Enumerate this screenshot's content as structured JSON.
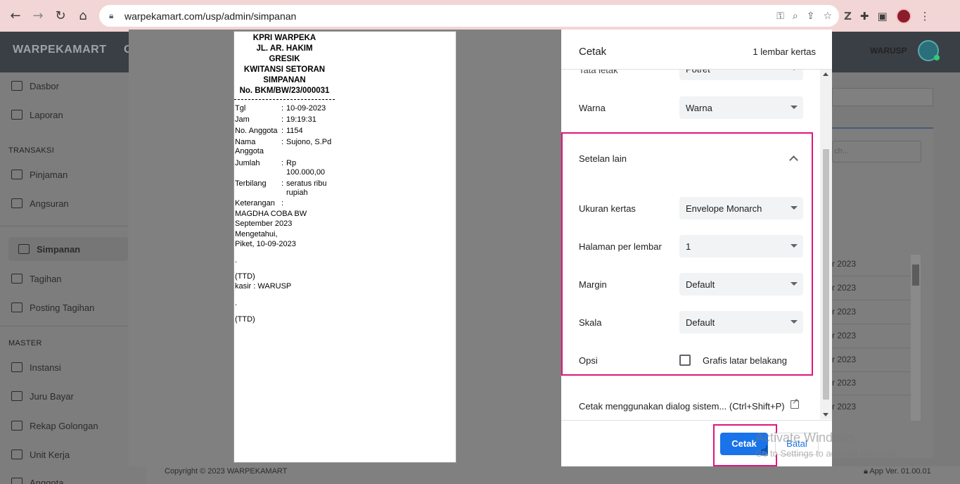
{
  "browser": {
    "url": "warpekamart.com/usp/admin/simpanan"
  },
  "app": {
    "brand": "WARPEKAMART",
    "brand_cut": "C",
    "user": "WARUSP",
    "sidebar": {
      "items_top": [
        {
          "label": "Dasbor",
          "icon": "dashboard-icon"
        },
        {
          "label": "Laporan",
          "icon": "report-icon"
        }
      ],
      "section_transaksi": "TRANSAKSI",
      "items_transaksi": [
        {
          "label": "Pinjaman",
          "icon": "cart-icon"
        },
        {
          "label": "Angsuran",
          "icon": "money-icon"
        }
      ],
      "active_item": {
        "label": "Simpanan",
        "icon": "bank-icon"
      },
      "items_after_active": [
        {
          "label": "Tagihan",
          "icon": "money-icon"
        },
        {
          "label": "Posting Tagihan",
          "icon": "document-icon"
        }
      ],
      "section_master": "MASTER",
      "items_master": [
        {
          "label": "Instansi",
          "icon": "book-icon"
        },
        {
          "label": "Juru Bayar",
          "icon": "book-icon"
        },
        {
          "label": "Rekap Golongan",
          "icon": "book-icon"
        },
        {
          "label": "Unit Kerja",
          "icon": "book-icon"
        },
        {
          "label": "Anggota",
          "icon": "book-icon"
        }
      ]
    },
    "search_placeholder": "ch...",
    "table_rows": [
      "r 2023",
      "r 2023",
      "r 2023",
      "r 2023",
      "r 2023",
      "r 2023",
      "r 2023"
    ],
    "copyright": "Copyright © 2023 WARPEKAMART",
    "app_version": "App Ver. 01.00.01"
  },
  "receipt": {
    "header_lines": [
      "KPRI WARPEKA",
      "JL. AR. HAKIM",
      "GRESIK",
      "KWITANSI SETORAN",
      "SIMPANAN",
      "No. BKM/BW/23/000031"
    ],
    "rows": [
      {
        "label": "Tgl",
        "sep": ":",
        "value": "10-09-2023"
      },
      {
        "label": "Jam",
        "sep": ":",
        "value": "19:19:31"
      },
      {
        "label": "No. Anggota",
        "sep": ":",
        "value": "1154"
      },
      {
        "label": "Nama Anggota",
        "sep": ":",
        "value": "Sujono, S.Pd"
      },
      {
        "label": "Jumlah",
        "sep": ":",
        "value": "Rp 100.000,00"
      },
      {
        "label": "Terbilang",
        "sep": ":",
        "value": "seratus ribu rupiah"
      },
      {
        "label": "Keterangan",
        "sep": ":",
        "value": ""
      }
    ],
    "lines": [
      "MAGDHA COBA BW",
      "September 2023",
      "Mengetahui,",
      "Piket, 10-09-2023",
      ".",
      "(TTD)",
      "kasir : WARUSP",
      ".",
      "(TTD)"
    ]
  },
  "print_dialog": {
    "title": "Cetak",
    "sheet_count": "1 lembar kertas",
    "layout": {
      "label": "Tata letak",
      "value": "Potret"
    },
    "color": {
      "label": "Warna",
      "value": "Warna"
    },
    "more_settings": "Setelan lain",
    "paper_size": {
      "label": "Ukuran kertas",
      "value": "Envelope Monarch"
    },
    "pages_per_sheet": {
      "label": "Halaman per lembar",
      "value": "1"
    },
    "margin": {
      "label": "Margin",
      "value": "Default"
    },
    "scale": {
      "label": "Skala",
      "value": "Default"
    },
    "options": {
      "label": "Opsi",
      "checkbox_label": "Grafis latar belakang",
      "checked": false
    },
    "system_dialog": "Cetak menggunakan dialog sistem... (Ctrl+Shift+P)",
    "print_button": "Cetak",
    "cancel_button": "Batal",
    "highlight_color": "#e0157d",
    "accent_color": "#1a73e8"
  },
  "watermark": {
    "line1": "Activate Windows",
    "line2": "Go to Settings to activate Windows."
  }
}
